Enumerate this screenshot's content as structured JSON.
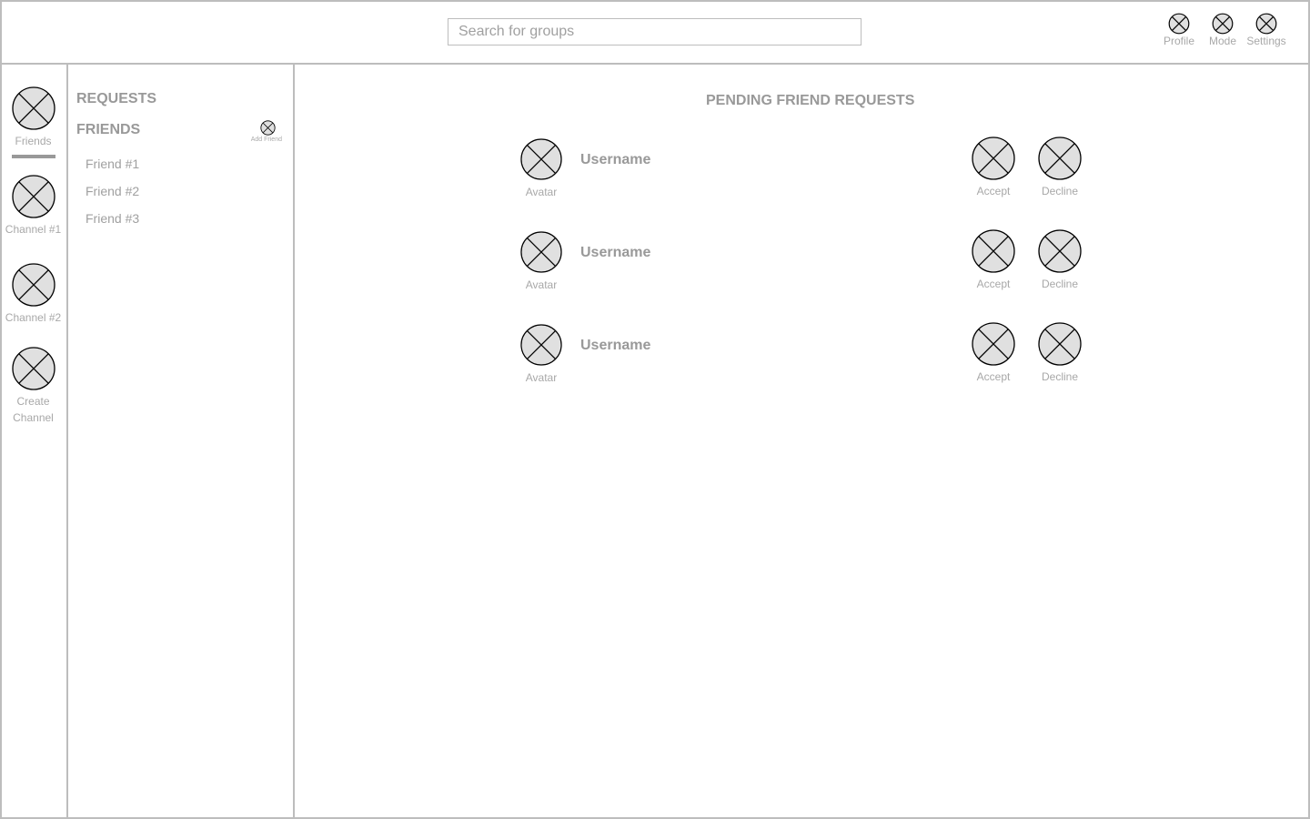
{
  "header": {
    "search_placeholder": "Search for groups",
    "search_value": "",
    "buttons": [
      {
        "label": "Profile",
        "icon": "profile-icon"
      },
      {
        "label": "Mode",
        "icon": "mode-icon"
      },
      {
        "label": "Settings",
        "icon": "settings-icon"
      }
    ]
  },
  "rail": {
    "items": [
      {
        "label": "Friends",
        "icon": "friends-icon",
        "active": true
      },
      {
        "label": "Channel #1",
        "icon": "channel-icon",
        "active": false
      },
      {
        "label": "Channel #2",
        "icon": "channel-icon",
        "active": false
      },
      {
        "label": "Create\nChannel",
        "label_line1": "Create",
        "label_line2": "Channel",
        "icon": "create-channel-icon",
        "active": false
      }
    ]
  },
  "panel": {
    "requests_title": "REQUESTS",
    "friends_title": "FRIENDS",
    "add_friend_label": "Add Friend",
    "friends": [
      "Friend #1",
      "Friend #2",
      "Friend #3"
    ]
  },
  "main": {
    "title": "PENDING FRIEND REQUESTS",
    "requests": [
      {
        "avatar_label": "Avatar",
        "username": "Username",
        "accept_label": "Accept",
        "decline_label": "Decline"
      },
      {
        "avatar_label": "Avatar",
        "username": "Username",
        "accept_label": "Accept",
        "decline_label": "Decline"
      },
      {
        "avatar_label": "Avatar",
        "username": "Username",
        "accept_label": "Accept",
        "decline_label": "Decline"
      }
    ]
  },
  "colors": {
    "border": "#bdbdbd",
    "text": "#999999",
    "placeholder_fill": "#e0e0e0",
    "icon_stroke": "#000000"
  }
}
